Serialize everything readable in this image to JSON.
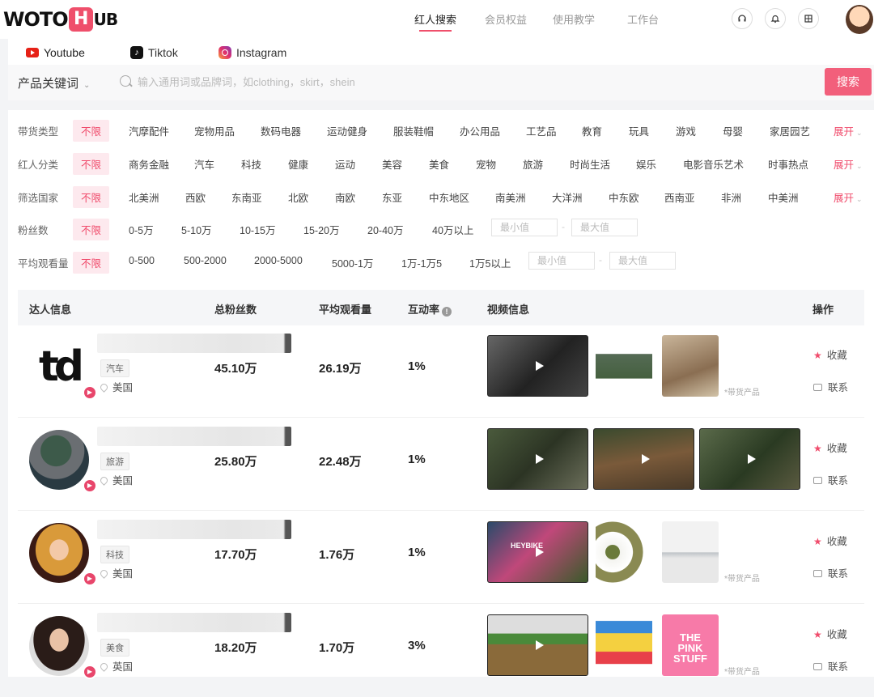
{
  "logo": {
    "part1": "WOTO",
    "h": "H",
    "part2": "UB"
  },
  "nav": [
    "红人搜索",
    "会员权益",
    "使用教学",
    "工作台"
  ],
  "top_icons": [
    "headset-icon",
    "bell-icon",
    "grid-icon"
  ],
  "platforms": [
    "Youtube",
    "Tiktok",
    "Instagram"
  ],
  "search": {
    "keyword_type": "产品关键词",
    "placeholder": "输入通用词或品牌词，如clothing，skirt，shein",
    "button": "搜索"
  },
  "filters": {
    "unlimited": "不限",
    "expand": "展开",
    "rows": [
      {
        "label": "带货类型",
        "options": [
          "汽摩配件",
          "宠物用品",
          "数码电器",
          "运动健身",
          "服装鞋帽",
          "办公用品",
          "工艺品",
          "教育",
          "玩具",
          "游戏",
          "母婴",
          "家居园艺"
        ]
      },
      {
        "label": "红人分类",
        "options": [
          "商务金融",
          "汽车",
          "科技",
          "健康",
          "运动",
          "美容",
          "美食",
          "宠物",
          "旅游",
          "时尚生活",
          "娱乐",
          "电影音乐艺术",
          "时事热点"
        ]
      },
      {
        "label": "筛选国家",
        "options": [
          "北美洲",
          "西欧",
          "东南亚",
          "北欧",
          "南欧",
          "东亚",
          "中东地区",
          "南美洲",
          "大洋洲",
          "中东欧",
          "西南亚",
          "非洲",
          "中美洲"
        ]
      },
      {
        "label": "粉丝数",
        "options": [
          "0-5万",
          "5-10万",
          "10-15万",
          "15-20万",
          "20-40万",
          "40万以上"
        ]
      },
      {
        "label": "平均观看量",
        "options": [
          "0-500",
          "500-2000",
          "2000-5000",
          "5000-1万",
          "1万-1万5",
          "1万5以上"
        ]
      }
    ],
    "min_placeholder": "最小值",
    "max_placeholder": "最大值"
  },
  "table": {
    "headers": [
      "达人信息",
      "总粉丝数",
      "平均观看量",
      "互动率",
      "视频信息",
      "操作"
    ],
    "product_tag": "*带货产品",
    "actions": [
      "收藏",
      "联系"
    ],
    "rows": [
      {
        "category": "汽车",
        "country": "美国",
        "followers": "45.10万",
        "avg_views": "26.19万",
        "engagement": "1%"
      },
      {
        "category": "旅游",
        "country": "美国",
        "followers": "25.80万",
        "avg_views": "22.48万",
        "engagement": "1%"
      },
      {
        "category": "科技",
        "country": "美国",
        "followers": "17.70万",
        "avg_views": "1.76万",
        "engagement": "1%"
      },
      {
        "category": "美食",
        "country": "英国",
        "followers": "18.20万",
        "avg_views": "1.70万",
        "engagement": "3%"
      }
    ],
    "thumb_texts": {
      "pink_stuff": "THE PINK STUFF",
      "heybike": "HEYBIKE"
    }
  },
  "colors": {
    "accent": "#f25f7b",
    "tag_bg": "#fde9ee"
  }
}
